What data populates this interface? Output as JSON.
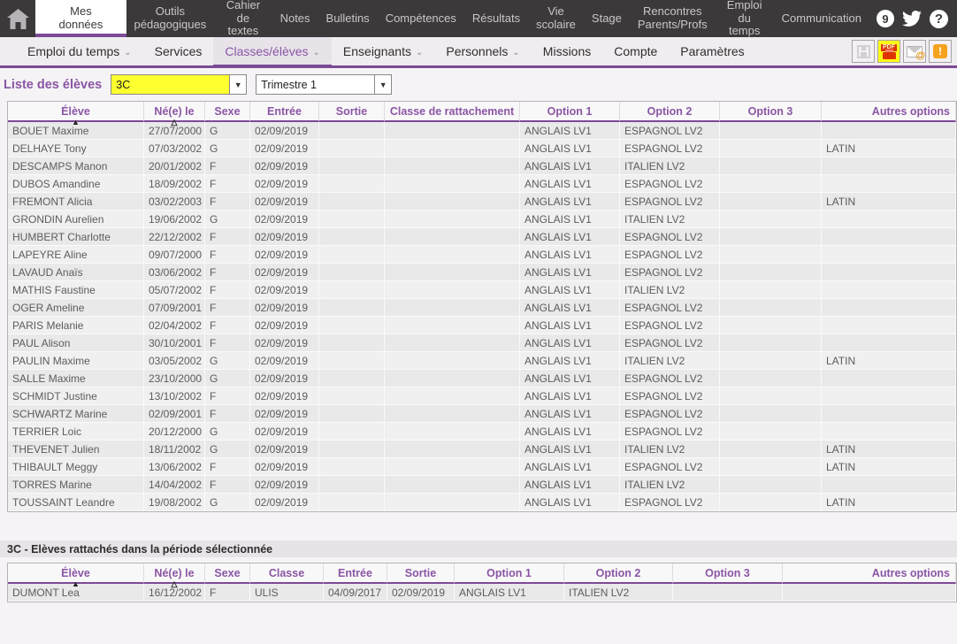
{
  "topnav": {
    "tabs": [
      {
        "label": "Mes données"
      },
      {
        "label": "Outils\npédagogiques"
      },
      {
        "label": "Cahier\nde textes"
      },
      {
        "label": "Notes"
      },
      {
        "label": "Bulletins"
      },
      {
        "label": "Compétences"
      },
      {
        "label": "Résultats"
      },
      {
        "label": "Vie\nscolaire"
      },
      {
        "label": "Stage"
      },
      {
        "label": "Rencontres\nParents/Profs"
      },
      {
        "label": "Emploi\ndu temps"
      },
      {
        "label": "Communication"
      }
    ],
    "notification_count": "9",
    "help_glyph": "?"
  },
  "subnav": {
    "items": [
      {
        "label": "Emploi du temps"
      },
      {
        "label": "Services"
      },
      {
        "label": "Classes/élèves"
      },
      {
        "label": "Enseignants"
      },
      {
        "label": "Personnels"
      },
      {
        "label": "Missions"
      },
      {
        "label": "Compte"
      },
      {
        "label": "Paramètres"
      }
    ],
    "pdf_label": "PDF"
  },
  "filters": {
    "label": "Liste des élèves",
    "class_value": "3C",
    "period_value": "Trimestre 1",
    "highlight_color": "#fdff2e"
  },
  "accent_colors": {
    "purple_line": "#7c4a96",
    "purple_text": "#8a56a4",
    "topbar_bg": "#3b393a"
  },
  "students_table": {
    "columns": [
      "Élève",
      "Né(e) le",
      "Sexe",
      "Entrée",
      "Sortie",
      "Classe de rattachement",
      "Option 1",
      "Option 2",
      "Option 3",
      "Autres options"
    ],
    "rows": [
      [
        "BOUET Maxime",
        "27/07/2000",
        "G",
        "02/09/2019",
        "",
        "",
        "ANGLAIS LV1",
        "ESPAGNOL LV2",
        "",
        ""
      ],
      [
        "DELHAYE Tony",
        "07/03/2002",
        "G",
        "02/09/2019",
        "",
        "",
        "ANGLAIS LV1",
        "ESPAGNOL LV2",
        "",
        "LATIN"
      ],
      [
        "DESCAMPS Manon",
        "20/01/2002",
        "F",
        "02/09/2019",
        "",
        "",
        "ANGLAIS LV1",
        "ITALIEN LV2",
        "",
        ""
      ],
      [
        "DUBOS Amandine",
        "18/09/2002",
        "F",
        "02/09/2019",
        "",
        "",
        "ANGLAIS LV1",
        "ESPAGNOL LV2",
        "",
        ""
      ],
      [
        "FREMONT Alicia",
        "03/02/2003",
        "F",
        "02/09/2019",
        "",
        "",
        "ANGLAIS LV1",
        "ESPAGNOL LV2",
        "",
        "LATIN"
      ],
      [
        "GRONDIN Aurelien",
        "19/06/2002",
        "G",
        "02/09/2019",
        "",
        "",
        "ANGLAIS LV1",
        "ITALIEN LV2",
        "",
        ""
      ],
      [
        "HUMBERT Charlotte",
        "22/12/2002",
        "F",
        "02/09/2019",
        "",
        "",
        "ANGLAIS LV1",
        "ESPAGNOL LV2",
        "",
        ""
      ],
      [
        "LAPEYRE Aline",
        "09/07/2000",
        "F",
        "02/09/2019",
        "",
        "",
        "ANGLAIS LV1",
        "ESPAGNOL LV2",
        "",
        ""
      ],
      [
        "LAVAUD Anaïs",
        "03/06/2002",
        "F",
        "02/09/2019",
        "",
        "",
        "ANGLAIS LV1",
        "ESPAGNOL LV2",
        "",
        ""
      ],
      [
        "MATHIS Faustine",
        "05/07/2002",
        "F",
        "02/09/2019",
        "",
        "",
        "ANGLAIS LV1",
        "ITALIEN LV2",
        "",
        ""
      ],
      [
        "OGER Ameline",
        "07/09/2001",
        "F",
        "02/09/2019",
        "",
        "",
        "ANGLAIS LV1",
        "ESPAGNOL LV2",
        "",
        ""
      ],
      [
        "PARIS Melanie",
        "02/04/2002",
        "F",
        "02/09/2019",
        "",
        "",
        "ANGLAIS LV1",
        "ESPAGNOL LV2",
        "",
        ""
      ],
      [
        "PAUL Alison",
        "30/10/2001",
        "F",
        "02/09/2019",
        "",
        "",
        "ANGLAIS LV1",
        "ESPAGNOL LV2",
        "",
        ""
      ],
      [
        "PAULIN Maxime",
        "03/05/2002",
        "G",
        "02/09/2019",
        "",
        "",
        "ANGLAIS LV1",
        "ITALIEN LV2",
        "",
        "LATIN"
      ],
      [
        "SALLE Maxime",
        "23/10/2000",
        "G",
        "02/09/2019",
        "",
        "",
        "ANGLAIS LV1",
        "ESPAGNOL LV2",
        "",
        ""
      ],
      [
        "SCHMIDT Justine",
        "13/10/2002",
        "F",
        "02/09/2019",
        "",
        "",
        "ANGLAIS LV1",
        "ESPAGNOL LV2",
        "",
        ""
      ],
      [
        "SCHWARTZ Marine",
        "02/09/2001",
        "F",
        "02/09/2019",
        "",
        "",
        "ANGLAIS LV1",
        "ESPAGNOL LV2",
        "",
        ""
      ],
      [
        "TERRIER Loic",
        "20/12/2000",
        "G",
        "02/09/2019",
        "",
        "",
        "ANGLAIS LV1",
        "ESPAGNOL LV2",
        "",
        ""
      ],
      [
        "THEVENET Julien",
        "18/11/2002",
        "G",
        "02/09/2019",
        "",
        "",
        "ANGLAIS LV1",
        "ITALIEN LV2",
        "",
        "LATIN"
      ],
      [
        "THIBAULT Meggy",
        "13/06/2002",
        "F",
        "02/09/2019",
        "",
        "",
        "ANGLAIS LV1",
        "ESPAGNOL LV2",
        "",
        "LATIN"
      ],
      [
        "TORRES Marine",
        "14/04/2002",
        "F",
        "02/09/2019",
        "",
        "",
        "ANGLAIS LV1",
        "ITALIEN LV2",
        "",
        ""
      ],
      [
        "TOUSSAINT Leandre",
        "19/08/2002",
        "G",
        "02/09/2019",
        "",
        "",
        "ANGLAIS LV1",
        "ESPAGNOL LV2",
        "",
        "LATIN"
      ]
    ]
  },
  "attached_section": {
    "title": "3C - Elèves rattachés dans la période sélectionnée",
    "columns": [
      "Élève",
      "Né(e) le",
      "Sexe",
      "Classe",
      "Entrée",
      "Sortie",
      "Option 1",
      "Option 2",
      "Option 3",
      "Autres options"
    ],
    "rows": [
      [
        "DUMONT Lea",
        "16/12/2002",
        "F",
        "ULIS",
        "04/09/2017",
        "02/09/2019",
        "ANGLAIS LV1",
        "ITALIEN LV2",
        "",
        ""
      ]
    ]
  }
}
